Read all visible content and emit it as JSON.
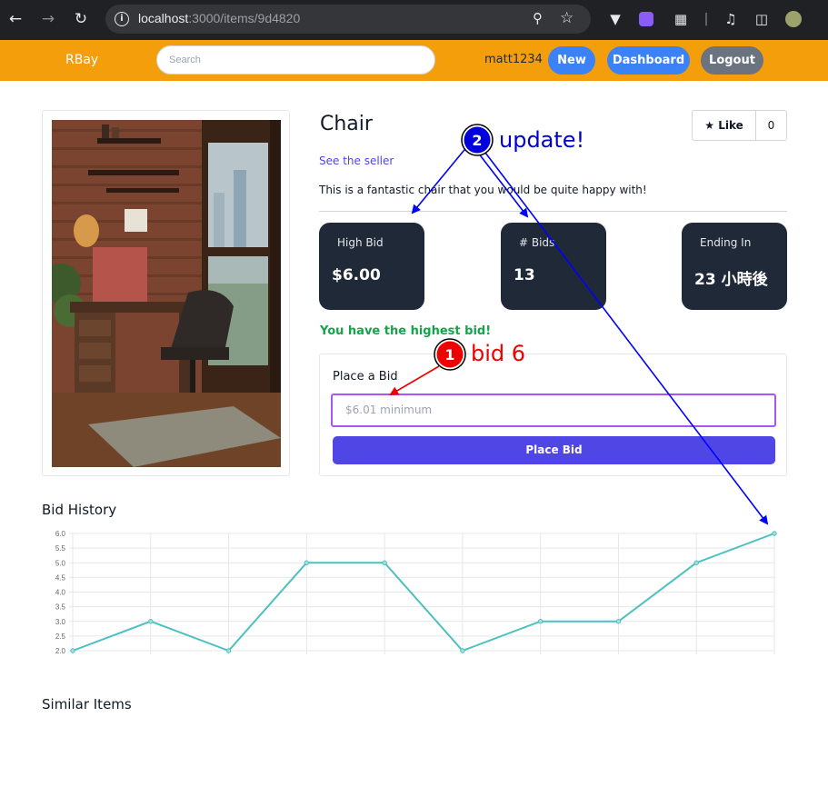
{
  "browser": {
    "url_host": "localhost",
    "url_rest": ":3000/items/9d4820"
  },
  "header": {
    "brand": "RBay",
    "search_placeholder": "Search",
    "username": "matt1234",
    "new_label": "New",
    "dashboard_label": "Dashboard",
    "logout_label": "Logout"
  },
  "item": {
    "title": "Chair",
    "like_label": "Like",
    "like_count": "0",
    "seller_link": "See the seller",
    "description": "This is a fantastic chair that you would be quite happy with!",
    "stats": [
      {
        "label": "High Bid",
        "value": "$6.00"
      },
      {
        "label": "# Bids",
        "value": "13"
      },
      {
        "label": "Ending In",
        "value": "23 小時後"
      }
    ],
    "highest_msg": "You have the highest bid!",
    "bid": {
      "label": "Place a Bid",
      "placeholder": "$6.01 minimum",
      "button": "Place Bid"
    }
  },
  "sections": {
    "history": "Bid History",
    "similar": "Similar Items"
  },
  "chart_data": {
    "type": "line",
    "title": "",
    "xlabel": "",
    "ylabel": "",
    "y_ticks": [
      "2.0",
      "2.5",
      "3.0",
      "3.5",
      "4.0",
      "4.5",
      "5.0",
      "5.5",
      "6.0"
    ],
    "ylim": [
      2.0,
      6.0
    ],
    "x": [
      1,
      2,
      3,
      4,
      5,
      6,
      7,
      8,
      9,
      10
    ],
    "values": [
      2,
      3,
      2,
      5,
      5,
      2,
      3,
      3,
      5,
      6
    ],
    "color": "#4bc0c0",
    "grid": true
  },
  "annotations": {
    "step1_number": "1",
    "step1_text": "bid 6",
    "step2_number": "2",
    "step2_text": "update!",
    "colors": {
      "step1": "#ff0000",
      "step2": "#0000cc"
    }
  }
}
